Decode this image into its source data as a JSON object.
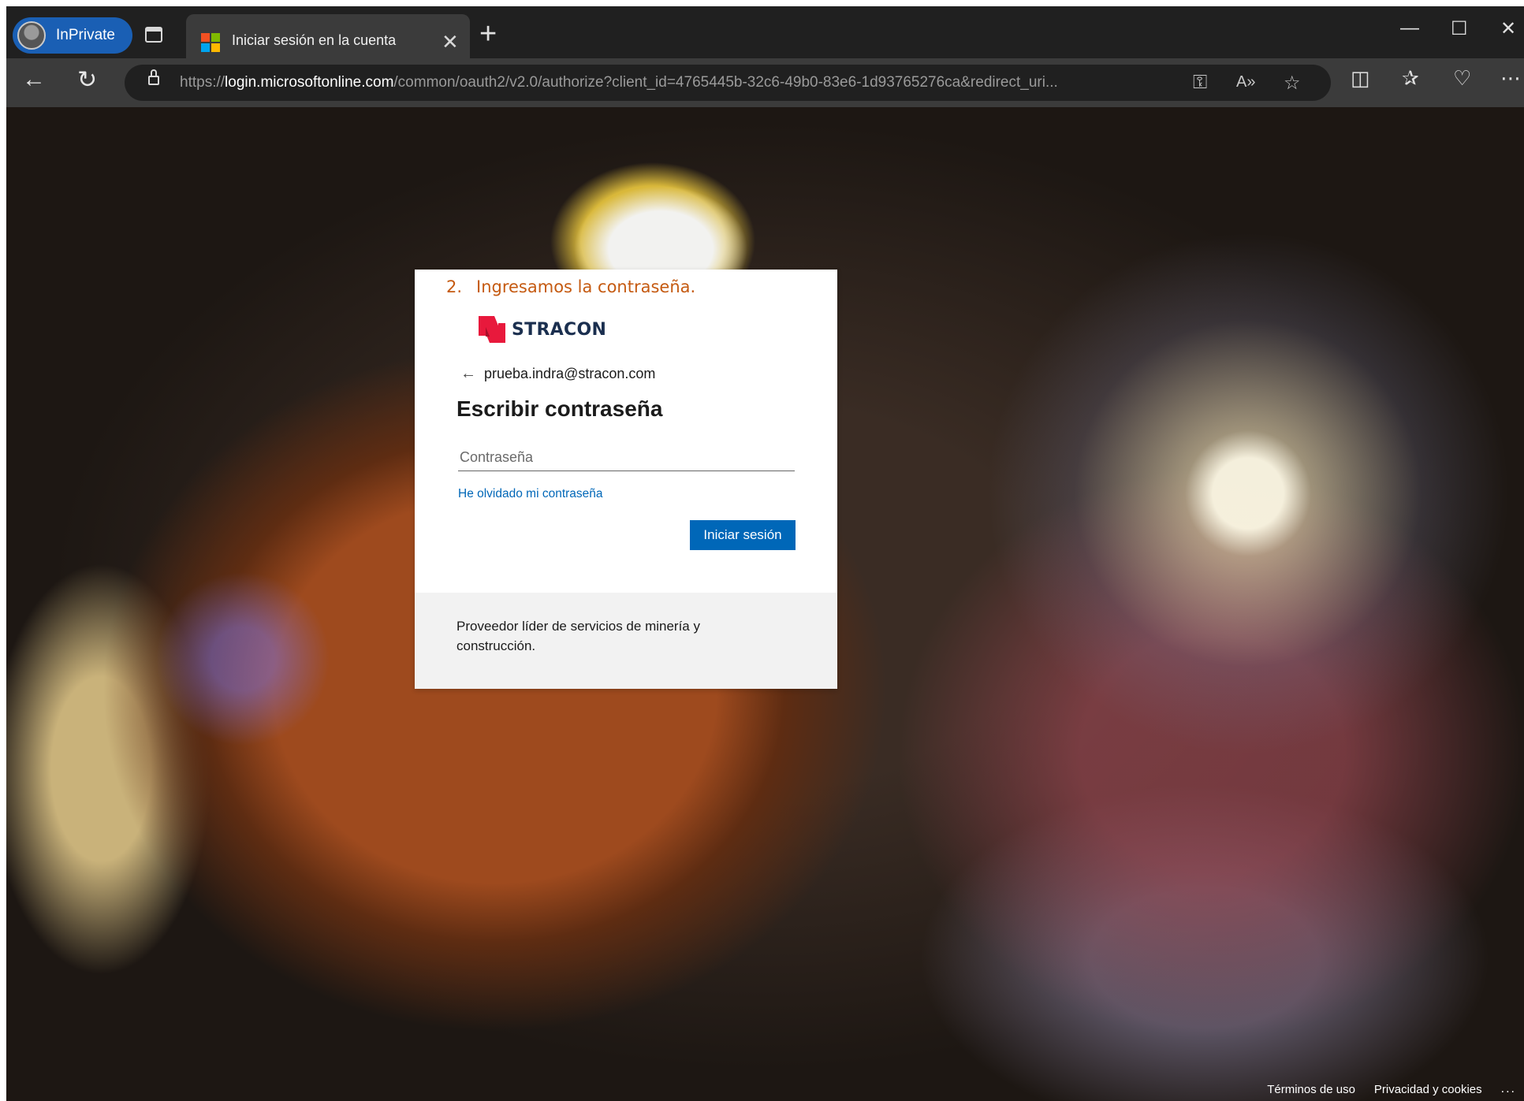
{
  "browser": {
    "inprivate_label": "InPrivate",
    "tab_title": "Iniciar sesión en la cuenta",
    "url_prefix": "https://",
    "url_host": "login.microsoftonline.com",
    "url_path": "/common/oauth2/v2.0/authorize?client_id=4765445b-32c6-49b0-83e6-1d93765276ca&redirect_uri..."
  },
  "annotation": {
    "number": "2.",
    "text": "Ingresamos la contraseña."
  },
  "login": {
    "brand": "STRACON",
    "email": "prueba.indra@stracon.com",
    "title": "Escribir contraseña",
    "password_placeholder": "Contraseña",
    "forgot_link": "He olvidado mi contraseña",
    "signin_button": "Iniciar sesión",
    "footer_text": "Proveedor líder de servicios de minería y construcción."
  },
  "footer": {
    "terms": "Términos de uso",
    "privacy": "Privacidad y cookies",
    "more": "..."
  },
  "colors": {
    "accent": "#0067b8",
    "annotation": "#c55a11",
    "brand_red": "#e8193c",
    "brand_navy": "#1b2f4f"
  }
}
